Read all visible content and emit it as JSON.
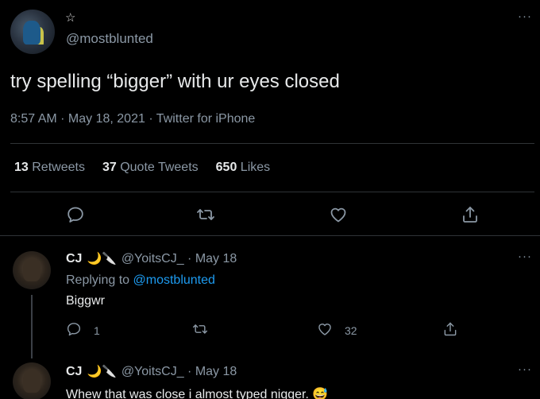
{
  "main_tweet": {
    "handle": "@mostblunted",
    "text": "try spelling “bigger” with ur eyes closed",
    "meta": "8:57 AM · May 18, 2021 · Twitter for iPhone",
    "stats": {
      "retweets_count": "13",
      "retweets_label": "Retweets",
      "quotes_count": "37",
      "quotes_label": "Quote Tweets",
      "likes_count": "650",
      "likes_label": "Likes"
    },
    "more": "···"
  },
  "replies": [
    {
      "name": "CJ",
      "emoji": "🌙🔪",
      "handle_date": "@YoitsCJ_ · May 18",
      "replying_prefix": "Replying to",
      "replying_to": "@mostblunted",
      "text": "Biggwr",
      "reply_count": "1",
      "like_count": "32",
      "more": "···"
    },
    {
      "name": "CJ",
      "emoji": "🌙🔪",
      "handle_date": "@YoitsCJ_ · May 18",
      "text": "Whew that was close i almost typed nigger. 😅",
      "more": "···"
    }
  ],
  "icons": {
    "star": "☆",
    "reply": "reply-icon",
    "retweet": "retweet-icon",
    "like": "heart-icon",
    "share": "share-icon"
  },
  "colors": {
    "background": "#000000",
    "text": "#e7e9ea",
    "muted": "#8b98a5",
    "link": "#1d9bf0",
    "divider": "#2f3336"
  }
}
